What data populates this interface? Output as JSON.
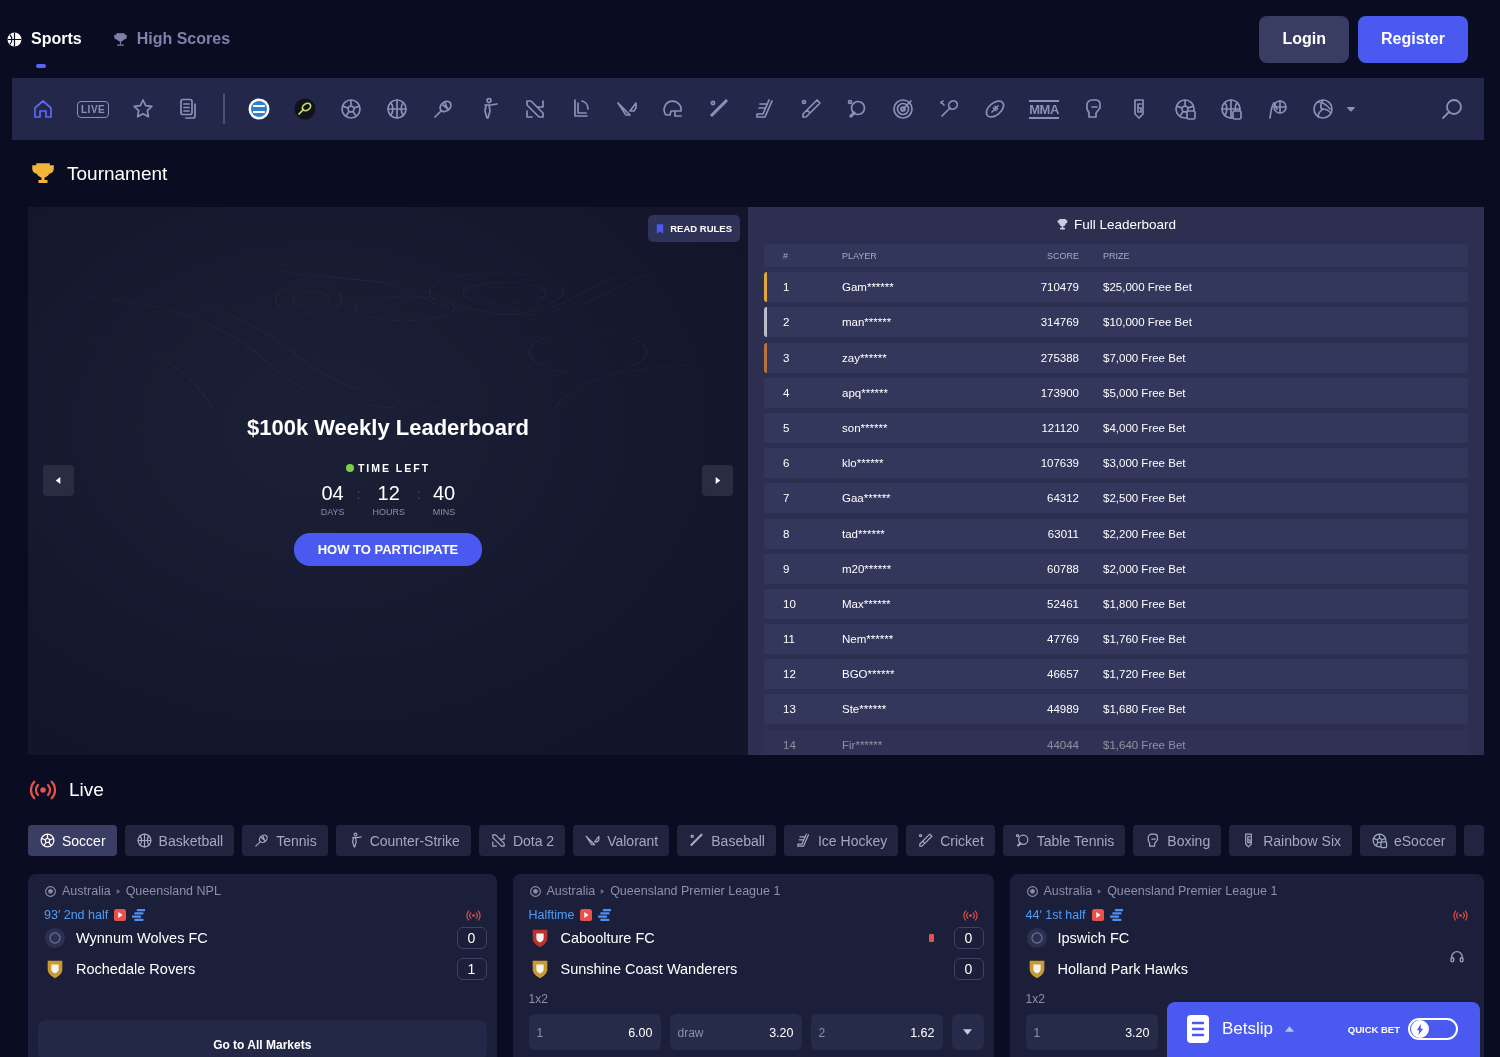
{
  "top_nav": {
    "items": [
      {
        "label": "Sports",
        "kind": "sports",
        "selected": true
      },
      {
        "label": "High Scores",
        "kind": "trophy",
        "selected": false
      }
    ],
    "buttons": [
      {
        "label": "Login",
        "kind": "secondary"
      },
      {
        "label": "Register",
        "kind": "primary"
      }
    ]
  },
  "icon_bar": [
    {
      "kind": "home",
      "selected": true
    },
    {
      "kind": "live",
      "label": "LIVE",
      "selected": false
    },
    {
      "kind": "star",
      "selected": false
    },
    {
      "kind": "betslips",
      "selected": false
    },
    {
      "kind": "divider"
    },
    {
      "kind": "round-badge",
      "selected": false
    },
    {
      "kind": "racket-badge",
      "selected": false
    },
    {
      "kind": "soccer",
      "selected": false
    },
    {
      "kind": "basketball",
      "selected": false
    },
    {
      "kind": "tennis",
      "selected": false
    },
    {
      "kind": "shooter",
      "selected": false
    },
    {
      "kind": "dota",
      "selected": false
    },
    {
      "kind": "lol",
      "selected": false
    },
    {
      "kind": "valorant",
      "selected": false
    },
    {
      "kind": "helmet",
      "selected": false
    },
    {
      "kind": "baseball",
      "selected": false
    },
    {
      "kind": "hockey",
      "selected": false
    },
    {
      "kind": "cricket",
      "selected": false
    },
    {
      "kind": "table-tennis",
      "selected": false
    },
    {
      "kind": "darts",
      "selected": false
    },
    {
      "kind": "badminton",
      "selected": false
    },
    {
      "kind": "football",
      "selected": false
    },
    {
      "kind": "mma",
      "label": "MMA",
      "selected": false
    },
    {
      "kind": "boxing",
      "selected": false
    },
    {
      "kind": "r6",
      "selected": false
    },
    {
      "kind": "esoccer",
      "selected": false
    },
    {
      "kind": "ebasketball",
      "selected": false
    },
    {
      "kind": "handball",
      "selected": false
    },
    {
      "kind": "volleyball",
      "selected": false
    },
    {
      "kind": "caret"
    }
  ],
  "tournament": {
    "title": "Tournament",
    "banner": {
      "read_rules": "READ RULES",
      "title": "$100k Weekly Leaderboard",
      "time_left": "TIME LEFT",
      "countdown": [
        {
          "value": "04",
          "unit": "DAYS"
        },
        {
          "value": "12",
          "unit": "HOURS"
        },
        {
          "value": "40",
          "unit": "MINS"
        }
      ],
      "separator": ":",
      "button": "HOW TO PARTICIPATE"
    },
    "leaderboard": {
      "title": "Full Leaderboard",
      "columns": [
        "#",
        "PLAYER",
        "SCORE",
        "PRIZE"
      ],
      "rows": [
        {
          "rank": "1",
          "player": "Gam******",
          "score": "710479",
          "prize": "$25,000 Free Bet",
          "color": "#e3a63c"
        },
        {
          "rank": "2",
          "player": "man******",
          "score": "314769",
          "prize": "$10,000 Free Bet",
          "color": "#b9bccb"
        },
        {
          "rank": "3",
          "player": "zay******",
          "score": "275388",
          "prize": "$7,000 Free Bet",
          "color": "#b8713f"
        },
        {
          "rank": "4",
          "player": "apq******",
          "score": "173900",
          "prize": "$5,000 Free Bet"
        },
        {
          "rank": "5",
          "player": "son******",
          "score": "121120",
          "prize": "$4,000 Free Bet"
        },
        {
          "rank": "6",
          "player": "klo******",
          "score": "107639",
          "prize": "$3,000 Free Bet"
        },
        {
          "rank": "7",
          "player": "Gaa******",
          "score": "64312",
          "prize": "$2,500 Free Bet"
        },
        {
          "rank": "8",
          "player": "tad******",
          "score": "63011",
          "prize": "$2,200 Free Bet"
        },
        {
          "rank": "9",
          "player": "m20******",
          "score": "60788",
          "prize": "$2,000 Free Bet"
        },
        {
          "rank": "10",
          "player": "Max******",
          "score": "52461",
          "prize": "$1,800 Free Bet"
        },
        {
          "rank": "11",
          "player": "Nem******",
          "score": "47769",
          "prize": "$1,760 Free Bet"
        },
        {
          "rank": "12",
          "player": "BGO******",
          "score": "46657",
          "prize": "$1,720 Free Bet"
        },
        {
          "rank": "13",
          "player": "Ste******",
          "score": "44989",
          "prize": "$1,680 Free Bet"
        },
        {
          "rank": "14",
          "player": "Fir******",
          "score": "44044",
          "prize": "$1,640 Free Bet"
        }
      ]
    }
  },
  "live": {
    "title": "Live",
    "tabs": [
      {
        "label": "Soccer",
        "kind": "soccer",
        "selected": true
      },
      {
        "label": "Basketball",
        "kind": "basketball",
        "selected": false
      },
      {
        "label": "Tennis",
        "kind": "tennis",
        "selected": false
      },
      {
        "label": "Counter-Strike",
        "kind": "shooter",
        "selected": false
      },
      {
        "label": "Dota 2",
        "kind": "dota",
        "selected": false
      },
      {
        "label": "Valorant",
        "kind": "valorant",
        "selected": false
      },
      {
        "label": "Baseball",
        "kind": "baseball",
        "selected": false
      },
      {
        "label": "Ice Hockey",
        "kind": "hockey",
        "selected": false
      },
      {
        "label": "Cricket",
        "kind": "cricket",
        "selected": false
      },
      {
        "label": "Table Tennis",
        "kind": "table-tennis",
        "selected": false
      },
      {
        "label": "Boxing",
        "kind": "boxing",
        "selected": false
      },
      {
        "label": "Rainbow Six",
        "kind": "r6",
        "selected": false
      },
      {
        "label": "eSoccer",
        "kind": "esoccer",
        "selected": false
      }
    ],
    "matches": [
      {
        "country": "Australia",
        "league": "Queensland NPL",
        "status": "93′ 2nd half",
        "teams": [
          {
            "name": "Wynnum Wolves FC",
            "score": "0",
            "kind": "generic",
            "red_card": false
          },
          {
            "name": "Rochedale Rovers",
            "score": "1",
            "kind": "crest",
            "red_card": false
          }
        ],
        "markets_button": "Go to All Markets"
      },
      {
        "country": "Australia",
        "league": "Queensland Premier League 1",
        "status": "Halftime",
        "teams": [
          {
            "name": "Caboolture FC",
            "score": "0",
            "kind": "crest",
            "red_card": true
          },
          {
            "name": "Sunshine Coast Wanderers",
            "score": "0",
            "kind": "crest",
            "red_card": false
          }
        ],
        "market": "1x2",
        "odds": [
          {
            "label": "1",
            "value": "6.00"
          },
          {
            "label": "draw",
            "value": "3.20"
          },
          {
            "label": "2",
            "value": "1.62"
          }
        ]
      },
      {
        "country": "Australia",
        "league": "Queensland Premier League 1",
        "status": "44′ 1st half",
        "teams": [
          {
            "name": "Ipswich FC",
            "kind": "generic",
            "red_card": false
          },
          {
            "name": "Holland Park Hawks",
            "kind": "crest",
            "red_card": false
          }
        ],
        "market": "1x2",
        "odds": [
          {
            "label": "1",
            "value": "3.20"
          }
        ]
      }
    ]
  },
  "betslip": {
    "title": "Betslip",
    "quick_bet": "QUICK BET",
    "quick_bet_on": false
  }
}
